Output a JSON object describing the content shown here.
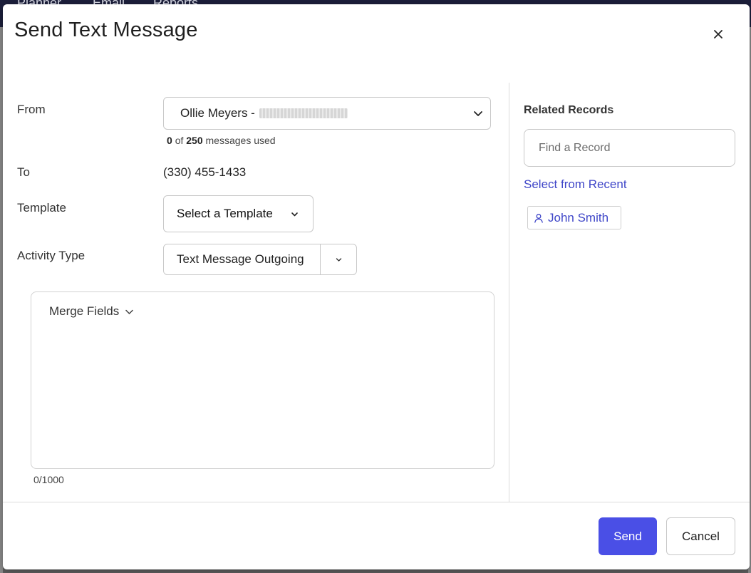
{
  "background": {
    "tabs": [
      "Planner",
      "Email",
      "Reports"
    ]
  },
  "modal": {
    "title": "Send Text Message",
    "close_label": "×"
  },
  "form": {
    "from_label": "From",
    "from_value": "Ollie Meyers -",
    "usage_used": "0",
    "usage_of": "of",
    "usage_total": "250",
    "usage_suffix": "messages used",
    "to_label": "To",
    "to_value": "(330) 455-1433",
    "template_label": "Template",
    "template_button": "Select a Template",
    "activity_label": "Activity Type",
    "activity_value": "Text Message Outgoing",
    "merge_fields": "Merge Fields",
    "char_count": "0/1000"
  },
  "related": {
    "title": "Related Records",
    "search_placeholder": "Find a Record",
    "select_recent": "Select from Recent",
    "records": [
      {
        "name": "John Smith"
      }
    ]
  },
  "footer": {
    "send": "Send",
    "cancel": "Cancel"
  },
  "colors": {
    "accent": "#4a4fe6",
    "link": "#3f46c8"
  }
}
